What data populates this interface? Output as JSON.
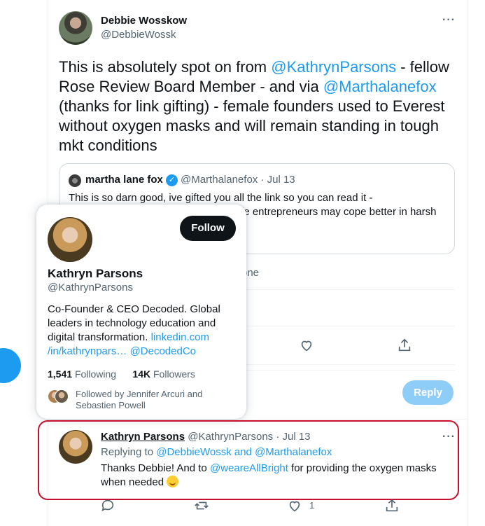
{
  "tweet": {
    "author_name": "Debbie Wosskow",
    "author_handle": "@DebbieWossk",
    "text_parts": [
      {
        "t": "This is absolutely spot on from ",
        "m": false
      },
      {
        "t": "@KathrynParsons",
        "m": true
      },
      {
        "t": " - fellow Rose Review Board Member - and via ",
        "m": false
      },
      {
        "t": "@Marthalanefox",
        "m": true
      },
      {
        "t": " (thanks for link gifting) - female founders used to Everest without oxygen masks and will remain standing in tough mkt conditions",
        "m": false
      }
    ],
    "more_icon": "more-horizontal-icon"
  },
  "quote": {
    "name": "martha lane fox",
    "handle_date": "@Marthalanefox · Jul 13",
    "text": "This is so darn good, ive gifted you all the link so you can read it - ",
    "text_line2_fragment": "le entrepreneurs may cope better in harsh"
  },
  "meta_partial": "one",
  "actions": [
    "reply-icon",
    "retweet-icon",
    "like-icon",
    "share-icon"
  ],
  "reply_button_label": "Reply",
  "hover_card": {
    "follow_label": "Follow",
    "name": "Kathryn Parsons",
    "handle": "@KathrynParsons",
    "bio": "Co-Founder & CEO Decoded.  Global leaders in technology education and digital transformation. ",
    "bio_link": "linkedin.com /in/kathrynpars…",
    "bio_mention": "@DecodedCo",
    "following_count": "1,541",
    "following_label": "Following",
    "followers_count": "14K",
    "followers_label": "Followers",
    "followed_by": "Followed by Jennifer Arcuri and Sebastien Powell"
  },
  "reply_tweet": {
    "name": "Kathryn Parsons",
    "meta": " @KathrynParsons · Jul 13",
    "replying_prefix": "Replying to ",
    "replying_mentions": "@DebbieWossk and @Marthalanefox",
    "text_before": "Thanks Debbie!  And to  ",
    "text_mention": "@weareAllBright",
    "text_after": " for providing the oxygen masks when needed ",
    "like_count": "1"
  },
  "colors": {
    "accent": "#1d9bf0",
    "text": "#0f1419",
    "secondary": "#536471",
    "highlight_border": "#c8102e"
  }
}
